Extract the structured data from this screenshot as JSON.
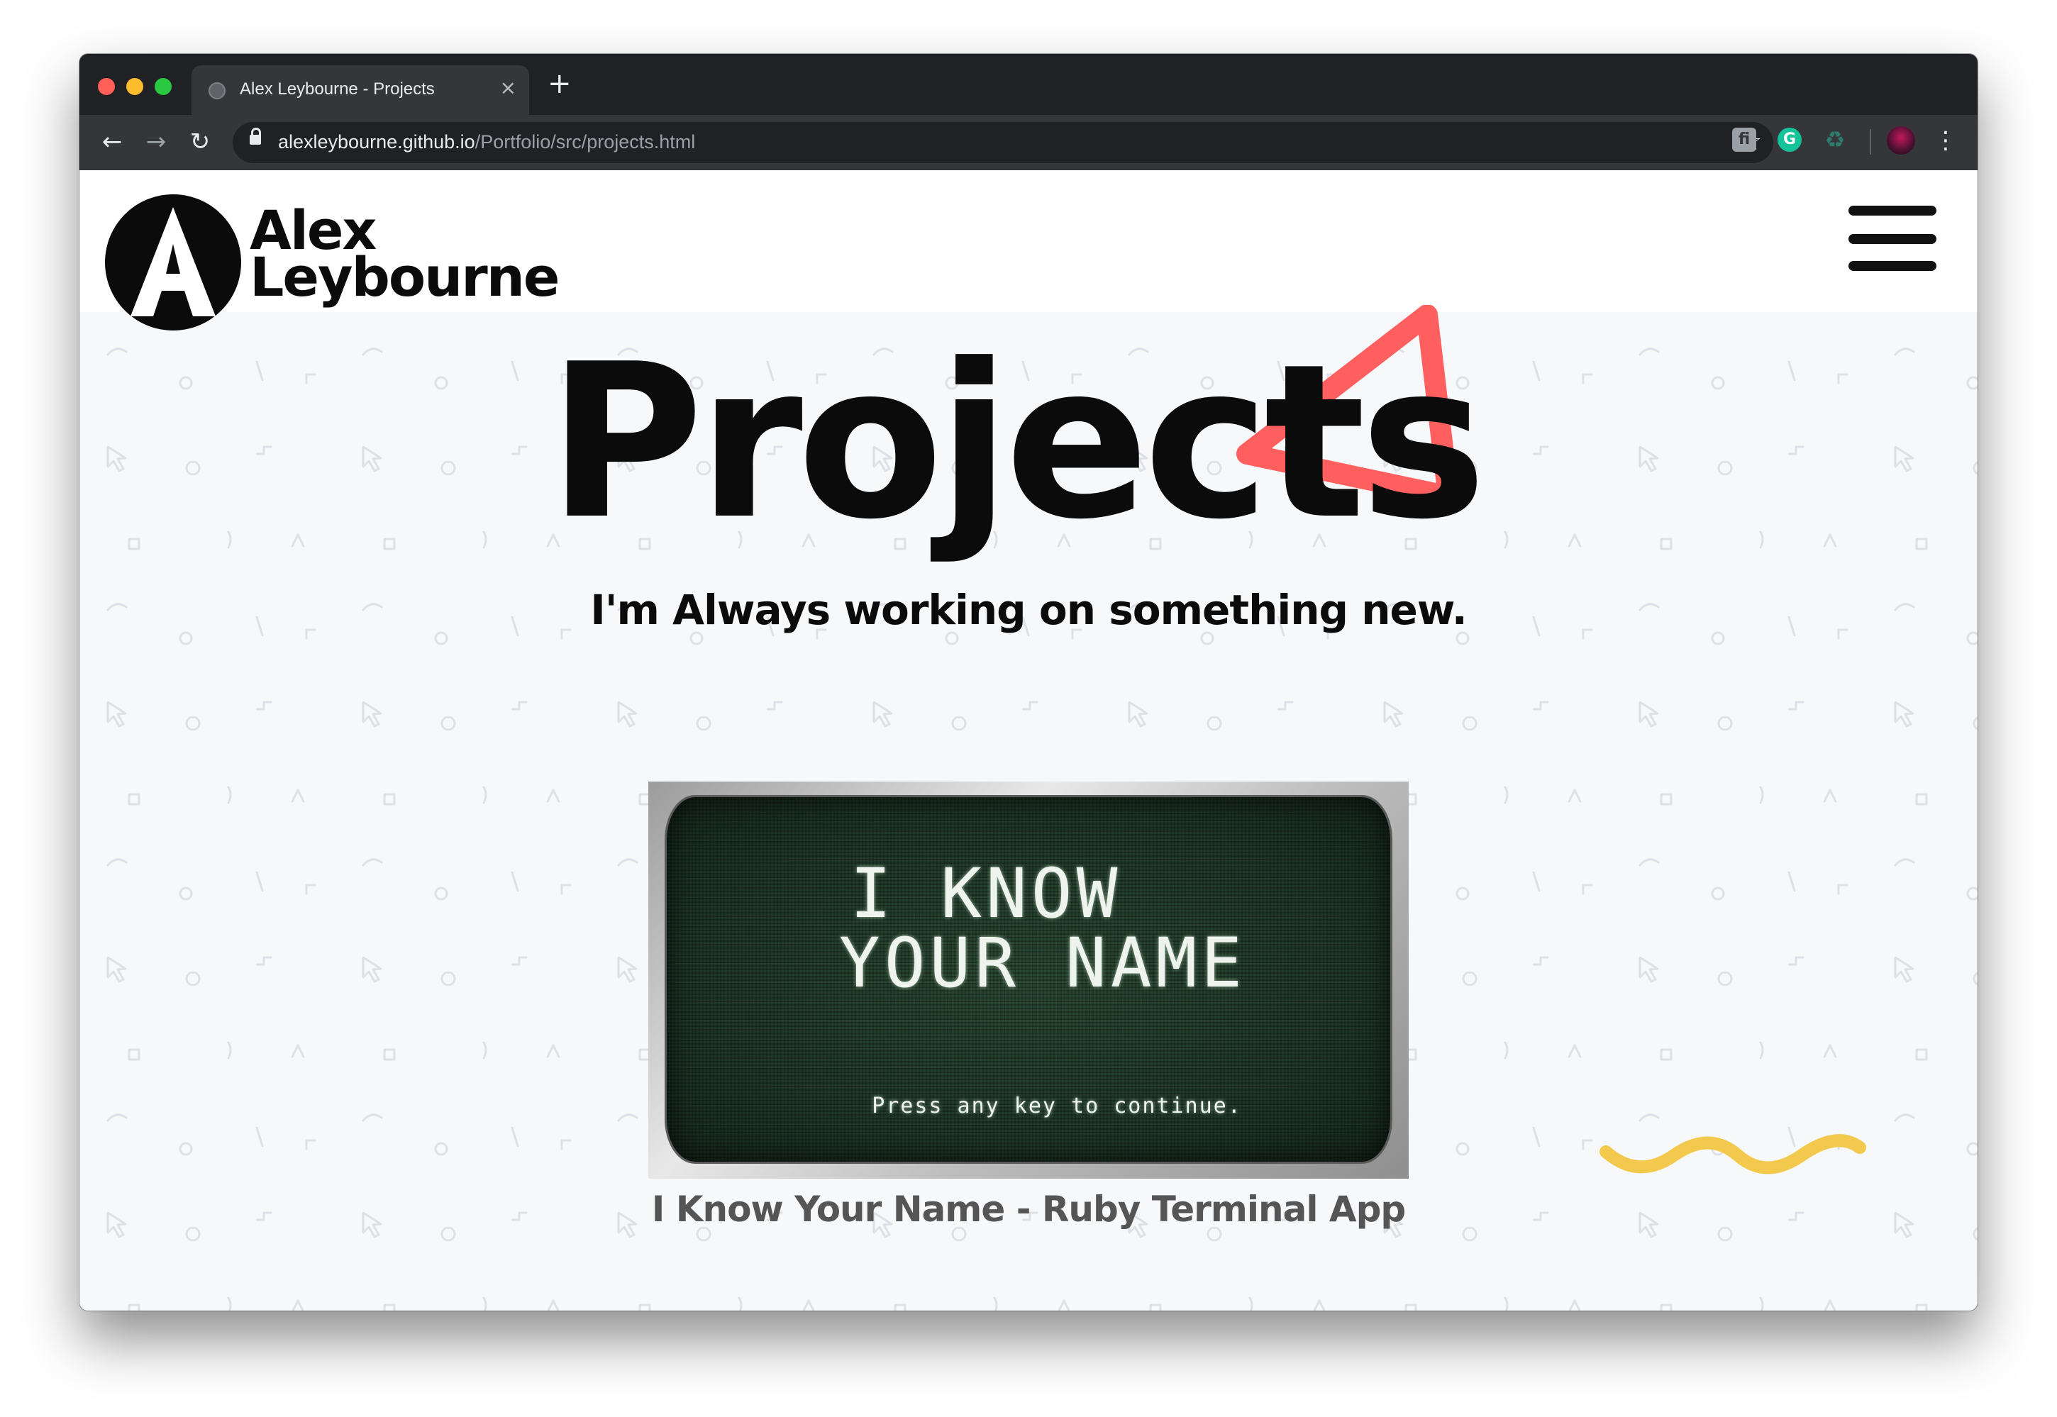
{
  "browser": {
    "tab_title": "Alex Leybourne - Projects",
    "close_glyph": "×",
    "new_tab_glyph": "+",
    "back_glyph": "←",
    "forward_glyph": "→",
    "reload_glyph": "↻",
    "url_host": "alexleybourne.github.io",
    "url_path": "/Portfolio/src/projects.html",
    "bookmark_glyph": "☆",
    "menu_glyph": "⋮",
    "extension_1_glyph": "fi",
    "extension_2_glyph": "G",
    "extension_3_glyph": "♻",
    "icons": [
      "globe-icon",
      "close-icon",
      "plus-icon",
      "back-arrow-icon",
      "forward-arrow-icon",
      "reload-icon",
      "lock-icon",
      "star-icon",
      "extension-icon",
      "grammarly-icon",
      "recycle-icon",
      "avatar",
      "more-vert-icon"
    ]
  },
  "site": {
    "logo_line1": "Alex",
    "logo_line2": "Leybourne",
    "page_title": "Projects",
    "tagline": "I'm Always working on something new.",
    "accent_triangle_color": "#ff5f5f",
    "squiggle_color": "#f2c94c"
  },
  "projects": [
    {
      "image_title_line1": "I KNOW",
      "image_title_line2": "YOUR NAME",
      "image_prompt": "Press any key to continue.",
      "caption": "I Know Your Name - Ruby Terminal App"
    }
  ]
}
